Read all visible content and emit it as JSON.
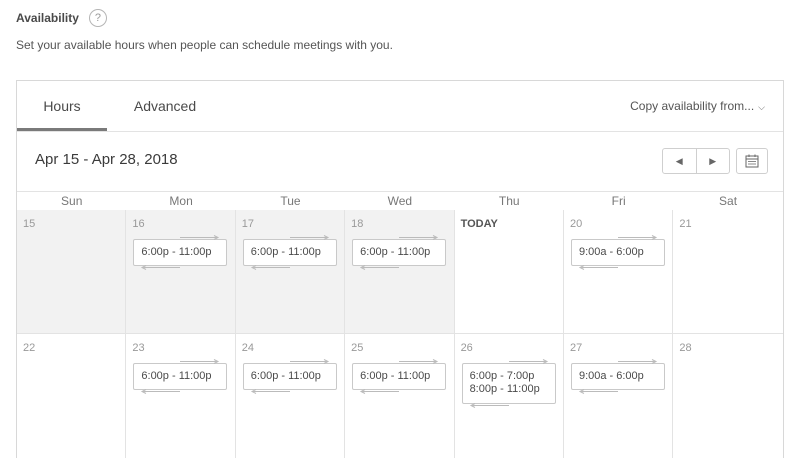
{
  "header": {
    "title": "Availability",
    "help_icon": "?",
    "subtitle": "Set your available hours when people can schedule meetings with you."
  },
  "tabs": [
    {
      "label": "Hours",
      "active": true
    },
    {
      "label": "Advanced",
      "active": false
    }
  ],
  "copy_menu": {
    "label": "Copy availability from..."
  },
  "calendar": {
    "date_range": "Apr 15 - Apr 28, 2018",
    "day_names": [
      "Sun",
      "Mon",
      "Tue",
      "Wed",
      "Thu",
      "Fri",
      "Sat"
    ],
    "weeks": [
      [
        {
          "label": "15",
          "past": true,
          "slots": []
        },
        {
          "label": "16",
          "past": true,
          "slots": [
            "6:00p - 11:00p"
          ]
        },
        {
          "label": "17",
          "past": true,
          "slots": [
            "6:00p - 11:00p"
          ]
        },
        {
          "label": "18",
          "past": true,
          "slots": [
            "6:00p - 11:00p"
          ]
        },
        {
          "label": "TODAY",
          "today": true,
          "slots": []
        },
        {
          "label": "20",
          "slots": [
            "9:00a - 6:00p"
          ]
        },
        {
          "label": "21",
          "slots": []
        }
      ],
      [
        {
          "label": "22",
          "slots": []
        },
        {
          "label": "23",
          "slots": [
            "6:00p - 11:00p"
          ]
        },
        {
          "label": "24",
          "slots": [
            "6:00p - 11:00p"
          ]
        },
        {
          "label": "25",
          "slots": [
            "6:00p - 11:00p"
          ]
        },
        {
          "label": "26",
          "slots": [
            "6:00p - 7:00p",
            "8:00p - 11:00p"
          ]
        },
        {
          "label": "27",
          "slots": [
            "9:00a - 6:00p"
          ]
        },
        {
          "label": "28",
          "slots": []
        }
      ]
    ]
  }
}
